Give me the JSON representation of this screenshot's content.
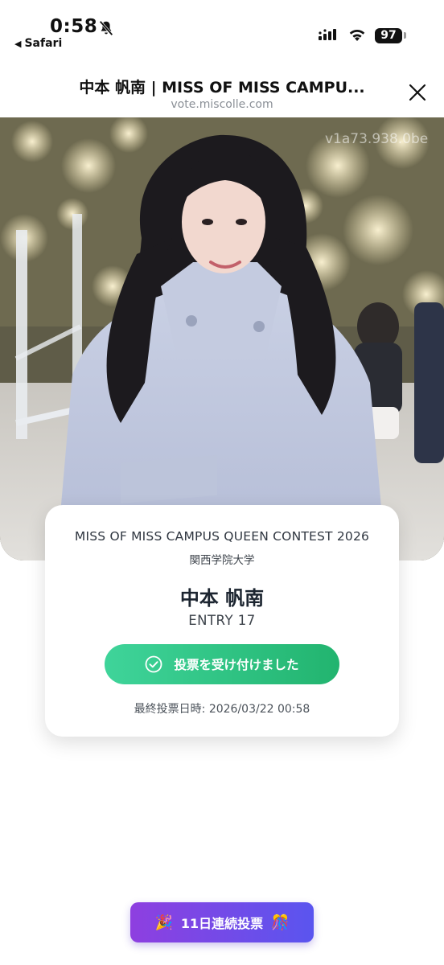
{
  "status_bar": {
    "time": "0:58",
    "back_app": "Safari",
    "battery": "97"
  },
  "header": {
    "title": "中本 帆南 | MISS OF MISS CAMPU...",
    "url": "vote.miscolle.com"
  },
  "photo": {
    "watermark": "v1a73.938.0be"
  },
  "card": {
    "contest_name": "MISS OF MISS CAMPUS QUEEN CONTEST 2026",
    "university": "関西学院大学",
    "candidate_name": "中本 帆南",
    "entry": "ENTRY 17",
    "vote_status": "投票を受け付けました",
    "last_vote": "最終投票日時: 2026/03/22 00:58"
  },
  "streak": {
    "label": "11日連続投票",
    "left_emoji": "🎉",
    "right_emoji": "🎊"
  },
  "colors": {
    "accent_green": "#22b46f",
    "accent_purple": "#8e3fe0"
  },
  "icons": [
    "bell-slash-icon",
    "signal-icon",
    "wifi-icon",
    "close-icon",
    "check-circle-icon"
  ]
}
